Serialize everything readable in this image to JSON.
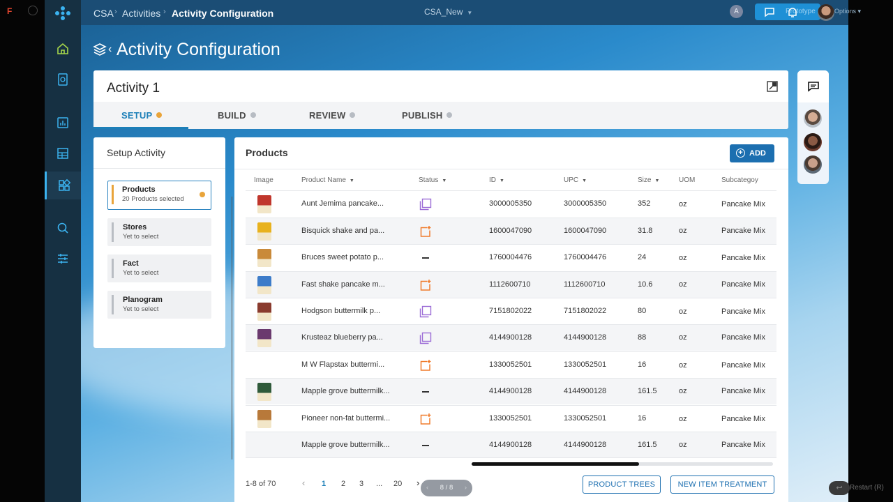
{
  "breadcrumb": [
    "CSA",
    "Activities",
    "Activity Configuration"
  ],
  "project": "CSA_New",
  "topbar": {
    "avatar_letter": "A",
    "prototype_label": "Prototype",
    "options_label": "Options"
  },
  "page_title": "Activity Configuration",
  "activity": {
    "title": "Activity 1",
    "tabs": [
      {
        "label": "SETUP",
        "state": "active"
      },
      {
        "label": "BUILD",
        "state": "pending"
      },
      {
        "label": "REVIEW",
        "state": "pending"
      },
      {
        "label": "PUBLISH",
        "state": "pending"
      }
    ]
  },
  "setup": {
    "title": "Setup Activity",
    "steps": [
      {
        "name": "Products",
        "sub": "20 Products selected"
      },
      {
        "name": "Stores",
        "sub": "Yet to select"
      },
      {
        "name": "Fact",
        "sub": "Yet to select"
      },
      {
        "name": "Planogram",
        "sub": "Yet to select"
      }
    ]
  },
  "products": {
    "title": "Products",
    "add_label": "ADD",
    "columns": [
      "Image",
      "Product Name",
      "Status",
      "ID",
      "UPC",
      "Size",
      "UOM",
      "Subcategoy"
    ],
    "rows": [
      {
        "name": "Aunt Jemima pancake...",
        "status": "copy",
        "id": "3000005350",
        "upc": "3000005350",
        "size": "352",
        "uom": "oz",
        "sub": "Pancake Mix",
        "thumb": "#c0362c"
      },
      {
        "name": "Bisquick shake and pa...",
        "status": "new",
        "id": "1600047090",
        "upc": "1600047090",
        "size": "31.8",
        "uom": "oz",
        "sub": "Pancake Mix",
        "thumb": "#e8b21e"
      },
      {
        "name": "Bruces sweet potato p...",
        "status": "none",
        "id": "1760004476",
        "upc": "1760004476",
        "size": "24",
        "uom": "oz",
        "sub": "Pancake Mix",
        "thumb": "#c98a3a"
      },
      {
        "name": "Fast shake pancake m...",
        "status": "new",
        "id": "1112600710",
        "upc": "1112600710",
        "size": "10.6",
        "uom": "oz",
        "sub": "Pancake Mix",
        "thumb": "#3d7cc9"
      },
      {
        "name": "Hodgson buttermilk p...",
        "status": "copy",
        "id": "7151802022",
        "upc": "7151802022",
        "size": "80",
        "uom": "oz",
        "sub": "Pancake Mix",
        "thumb": "#8a3b2e"
      },
      {
        "name": "Krusteaz blueberry pa...",
        "status": "copy",
        "id": "4144900128",
        "upc": "4144900128",
        "size": "88",
        "uom": "oz",
        "sub": "Pancake Mix",
        "thumb": "#6a3a6e"
      },
      {
        "name": "M W Flapstax buttermi...",
        "status": "new",
        "id": "1330052501",
        "upc": "1330052501",
        "size": "16",
        "uom": "oz",
        "sub": "Pancake Mix",
        "thumb": ""
      },
      {
        "name": "Mapple grove buttermilk...",
        "status": "none",
        "id": "4144900128",
        "upc": "4144900128",
        "size": "161.5",
        "uom": "oz",
        "sub": "Pancake Mix",
        "thumb": "#2f5a3a"
      },
      {
        "name": "Pioneer non-fat buttermi...",
        "status": "new",
        "id": "1330052501",
        "upc": "1330052501",
        "size": "16",
        "uom": "oz",
        "sub": "Pancake Mix",
        "thumb": "#b8793a"
      },
      {
        "name": "Mapple grove buttermilk...",
        "status": "none",
        "id": "4144900128",
        "upc": "4144900128",
        "size": "161.5",
        "uom": "oz",
        "sub": "Pancake Mix",
        "thumb": ""
      }
    ]
  },
  "pagination": {
    "range": "1-8 of 70",
    "pages": [
      "1",
      "2",
      "3",
      "...",
      "20"
    ],
    "current": "1"
  },
  "actions": {
    "product_trees": "PRODUCT TREES",
    "new_item_treatment": "NEW ITEM TREATMENT"
  },
  "slide_indicator": "8 / 8",
  "restart_label": "Restart (R)",
  "colors": {
    "accent": "#1c7fb8",
    "status_orange": "#f07b2b",
    "status_purple": "#9b6bd6",
    "step_active": "#e9a43a"
  }
}
